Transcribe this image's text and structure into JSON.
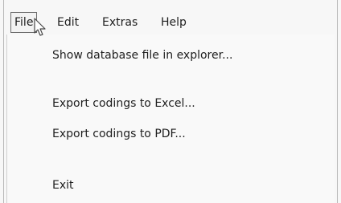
{
  "menubar": {
    "items": [
      {
        "label": "File"
      },
      {
        "label": "Edit"
      },
      {
        "label": "Extras"
      },
      {
        "label": "Help"
      }
    ]
  },
  "file_menu": {
    "items": [
      {
        "label": "Show database file in explorer..."
      },
      {
        "label": "Export codings to Excel..."
      },
      {
        "label": "Export codings to PDF..."
      },
      {
        "label": "Exit"
      }
    ]
  },
  "cursor": {
    "icon": "mouse-pointer-icon"
  },
  "colors": {
    "menu_background": "#f7f7f7",
    "active_border": "#6e6e6e",
    "text": "#1e1e1e"
  }
}
